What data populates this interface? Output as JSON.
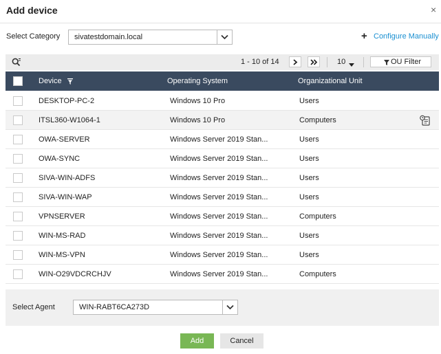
{
  "dialog": {
    "title": "Add device",
    "close_glyph": "×"
  },
  "category": {
    "label": "Select Category",
    "value": "sivatestdomain.local"
  },
  "configure": {
    "label": "Configure Manually",
    "icon": "plus-icon"
  },
  "toolbar": {
    "range": "1 - 10 of 14",
    "page_size": "10",
    "ou_filter": "OU Filter"
  },
  "columns": {
    "device": "Device",
    "os": "Operating System",
    "ou": "Organizational Unit"
  },
  "rows": [
    {
      "device": "DESKTOP-PC-2",
      "os": "Windows 10 Pro",
      "ou": "Users"
    },
    {
      "device": "ITSL360-W1064-1",
      "os": "Windows 10 Pro",
      "ou": "Computers"
    },
    {
      "device": "OWA-SERVER",
      "os": "Windows Server 2019 Stan...",
      "ou": "Users"
    },
    {
      "device": "OWA-SYNC",
      "os": "Windows Server 2019 Stan...",
      "ou": "Users"
    },
    {
      "device": "SIVA-WIN-ADFS",
      "os": "Windows Server 2019 Stan...",
      "ou": "Users"
    },
    {
      "device": "SIVA-WIN-WAP",
      "os": "Windows Server 2019 Stan...",
      "ou": "Users"
    },
    {
      "device": "VPNSERVER",
      "os": "Windows Server 2019 Stan...",
      "ou": "Computers"
    },
    {
      "device": "WIN-MS-RAD",
      "os": "Windows Server 2019 Stan...",
      "ou": "Users"
    },
    {
      "device": "WIN-MS-VPN",
      "os": "Windows Server 2019 Stan...",
      "ou": "Users"
    },
    {
      "device": "WIN-O29VDCRCHJV",
      "os": "Windows Server 2019 Stan...",
      "ou": "Computers"
    }
  ],
  "agent": {
    "label": "Select Agent",
    "value": "WIN-RABT6CA273D"
  },
  "buttons": {
    "add": "Add",
    "cancel": "Cancel"
  },
  "colors": {
    "header_bg": "#3a4a5f",
    "link": "#1a8fd1",
    "add_button": "#79b755"
  }
}
